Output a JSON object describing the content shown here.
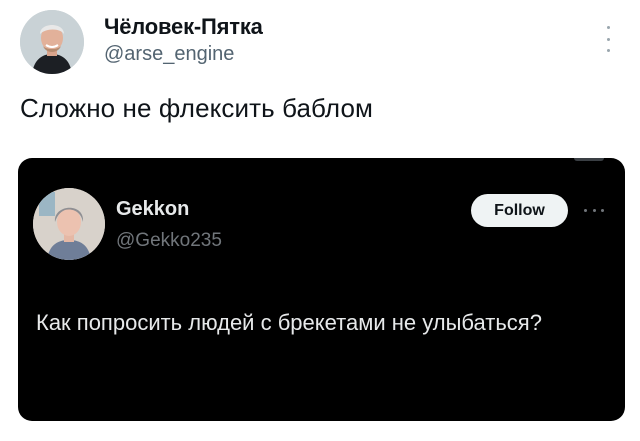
{
  "tweet": {
    "author": {
      "display_name": "Чёловек-Пятка",
      "handle": "@arse_engine",
      "avatar_icon": "user-avatar-icon"
    },
    "text": "Сложно не флексить баблом",
    "more_icon": "more-vertical-icon"
  },
  "embedded_tweet": {
    "author": {
      "display_name": "Gekkon",
      "handle": "@Gekko235",
      "avatar_icon": "user-avatar-icon"
    },
    "follow_label": "Follow",
    "more_icon": "more-horizontal-icon",
    "text": "Как попросить людей с брекетами не улыбаться?"
  },
  "colors": {
    "page_bg": "#ffffff",
    "embed_bg": "#000000",
    "primary_text": "#0f1419",
    "secondary_text": "#536471",
    "dark_primary_text": "#e7e9ea",
    "dark_secondary_text": "#71767b",
    "follow_button_bg": "#eff3f4"
  }
}
